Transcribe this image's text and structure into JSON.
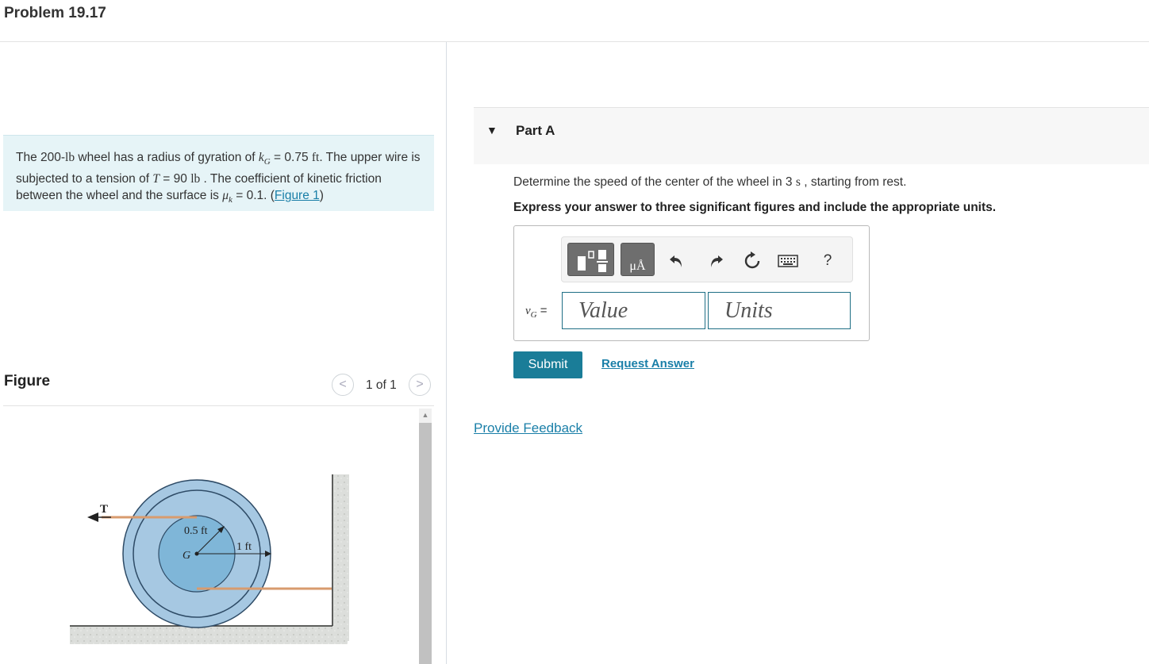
{
  "problem": {
    "title": "Problem 19.17",
    "text": {
      "p1": "The 200-",
      "u1": "lb",
      "p2": " wheel has a radius of gyration of ",
      "k": "k",
      "kg_sub": "G",
      "p3": " = 0.75 ",
      "u2": "ft",
      "p4": ". The upper wire is subjected to a tension of ",
      "T": "T",
      "p5": " = 90  ",
      "u3": "lb",
      "p6": " . The coefficient of kinetic friction between the wheel and the surface is ",
      "mu": "μ",
      "mu_sub": "k",
      "p7": " = 0.1. (",
      "figure_link": "Figure 1",
      "p8": ")"
    }
  },
  "figure": {
    "label": "Figure",
    "pager": "1 of 1",
    "prev_glyph": "<",
    "next_glyph": ">",
    "labels": {
      "tension": "T",
      "inner_radius": "0.5 ft",
      "outer_radius": "1 ft",
      "center": "G"
    },
    "colors": {
      "outer": "#a6c8e2",
      "ring": "#2e4b66",
      "inner": "#7fb6d8",
      "wire": "#d89b6e",
      "ground": "#d9dbd7"
    }
  },
  "part_a": {
    "title": "Part A",
    "question_prefix": "Determine the speed of the center of the wheel in 3 ",
    "question_unit": "s",
    "question_suffix": " , starting from rest.",
    "instruction": "Express your answer to three significant figures and include the appropriate units.",
    "toolbar": {
      "units_glyph": "μÅ",
      "help": "?",
      "icons": [
        "templates-icon",
        "units-icon",
        "undo-icon",
        "redo-icon",
        "reset-icon",
        "keyboard-icon",
        "help-icon"
      ]
    },
    "variable": "v",
    "variable_sub": "G",
    "equals": " =",
    "value_placeholder": "Value",
    "units_placeholder": "Units",
    "submit": "Submit",
    "request_answer": "Request Answer"
  },
  "feedback": "Provide Feedback",
  "colors": {
    "accent": "#1a7d98",
    "link": "#1a7fa8",
    "problem_bg": "#e6f4f7"
  }
}
